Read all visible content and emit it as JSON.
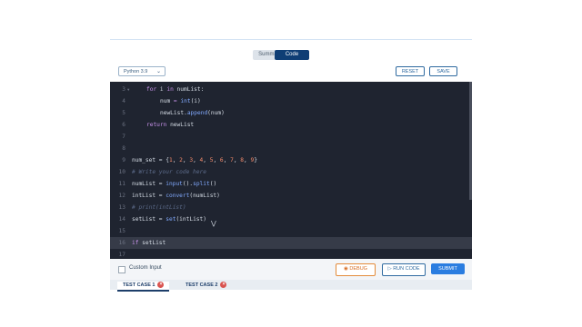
{
  "tabs": {
    "summary": "Summary",
    "code": "Code"
  },
  "toolbar": {
    "language": "Python 3.9",
    "reset": "RESET",
    "save": "SAVE"
  },
  "editor": {
    "lines": [
      {
        "n": "3",
        "text": ""
      },
      {
        "n": "4",
        "text": ""
      },
      {
        "n": "5",
        "text": ""
      },
      {
        "n": "6",
        "text": ""
      },
      {
        "n": "7",
        "text": ""
      },
      {
        "n": "8",
        "text": ""
      },
      {
        "n": "9",
        "text": ""
      },
      {
        "n": "10",
        "text": ""
      },
      {
        "n": "11",
        "text": ""
      },
      {
        "n": "12",
        "text": ""
      },
      {
        "n": "13",
        "text": ""
      },
      {
        "n": "14",
        "text": ""
      },
      {
        "n": "15",
        "text": ""
      },
      {
        "n": "16",
        "text": ""
      },
      {
        "n": "17",
        "text": ""
      }
    ],
    "code_text": {
      "l3": "for i in numList:",
      "l4": "num = int(i)",
      "l5": "newList.append(num)",
      "l6": "return newList",
      "l9": "num_set = {1, 2, 3, 4, 5, 6, 7, 8, 9}",
      "l10": "# Write your code here",
      "l11": "numList = input().split()",
      "l12": "intList = convert(numList)",
      "l13": "# print(intList)",
      "l14": "setList = set(intList)",
      "l16": "if setList"
    }
  },
  "bottom": {
    "custom_input": "Custom Input",
    "debug": "DEBUG",
    "run_code": "RUN CODE",
    "submit": "SUBMIT",
    "test_cases": [
      "TEST CASE 1",
      "TEST CASE 2"
    ]
  }
}
